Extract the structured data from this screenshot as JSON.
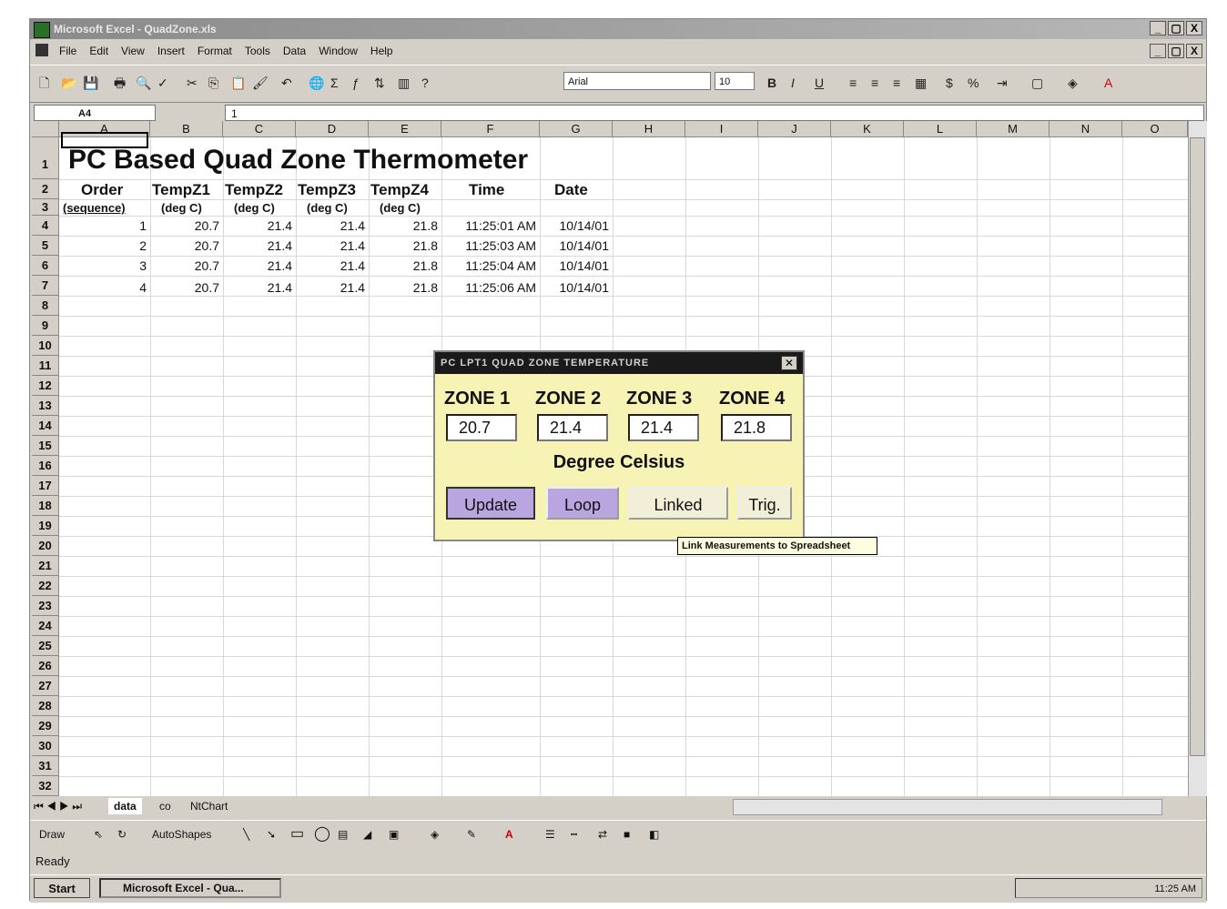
{
  "window": {
    "title": "Microsoft Excel - QuadZone.xls",
    "controls": [
      "_",
      "▢",
      "X"
    ]
  },
  "menu": {
    "items": [
      "File",
      "Edit",
      "View",
      "Insert",
      "Format",
      "Tools",
      "Data",
      "Window",
      "Help"
    ],
    "doc_controls": [
      "_",
      "▢",
      "X"
    ]
  },
  "toolbar": {
    "font": "Arial",
    "size": "10"
  },
  "formula_bar": {
    "name_box": "A4",
    "value": "1"
  },
  "columns": [
    "A",
    "B",
    "C",
    "D",
    "E",
    "F",
    "G",
    "H",
    "I",
    "J",
    "K",
    "L",
    "M",
    "N",
    "O"
  ],
  "rows": [
    "1",
    "2",
    "3",
    "4",
    "5",
    "6",
    "7",
    "8",
    "9",
    "10",
    "11",
    "12",
    "13",
    "14",
    "15",
    "16",
    "17",
    "18",
    "19",
    "20",
    "21",
    "22",
    "23",
    "24",
    "25",
    "26",
    "27",
    "28",
    "29",
    "30",
    "31",
    "32"
  ],
  "sheet": {
    "title": "PC Based Quad Zone Thermometer",
    "headers": [
      "Order",
      "TempZ1",
      "TempZ2",
      "TempZ3",
      "TempZ4",
      "Time",
      "Date"
    ],
    "units": [
      "(sequence)",
      "(deg C)",
      "(deg C)",
      "(deg C)",
      "(deg C)"
    ],
    "data": [
      [
        "1",
        "20.7",
        "21.4",
        "21.4",
        "21.8",
        "11:25:01 AM",
        "10/14/01"
      ],
      [
        "2",
        "20.7",
        "21.4",
        "21.4",
        "21.8",
        "11:25:03 AM",
        "10/14/01"
      ],
      [
        "3",
        "20.7",
        "21.4",
        "21.4",
        "21.8",
        "11:25:04 AM",
        "10/14/01"
      ],
      [
        "4",
        "20.7",
        "21.4",
        "21.4",
        "21.8",
        "11:25:06 AM",
        "10/14/01"
      ]
    ]
  },
  "dialog": {
    "title": "PC LPT1  QUAD ZONE TEMPERATURE",
    "zones": [
      "ZONE 1",
      "ZONE 2",
      "ZONE 3",
      "ZONE 4"
    ],
    "values": [
      "20.7",
      "21.4",
      "21.4",
      "21.8"
    ],
    "unit": "Degree Celsius",
    "buttons": [
      "Update",
      "Loop",
      "Linked",
      "Trig."
    ],
    "tooltip": "Link Measurements to Spreadsheet"
  },
  "sheet_tabs": [
    "data",
    "co",
    "NtChart"
  ],
  "drawing": {
    "draw": "Draw",
    "autoshapes": "AutoShapes"
  },
  "status": {
    "text": "Ready"
  },
  "taskbar": {
    "start": "Start",
    "item": "Microsoft Excel - Qua...",
    "clock": "11:25 AM"
  }
}
